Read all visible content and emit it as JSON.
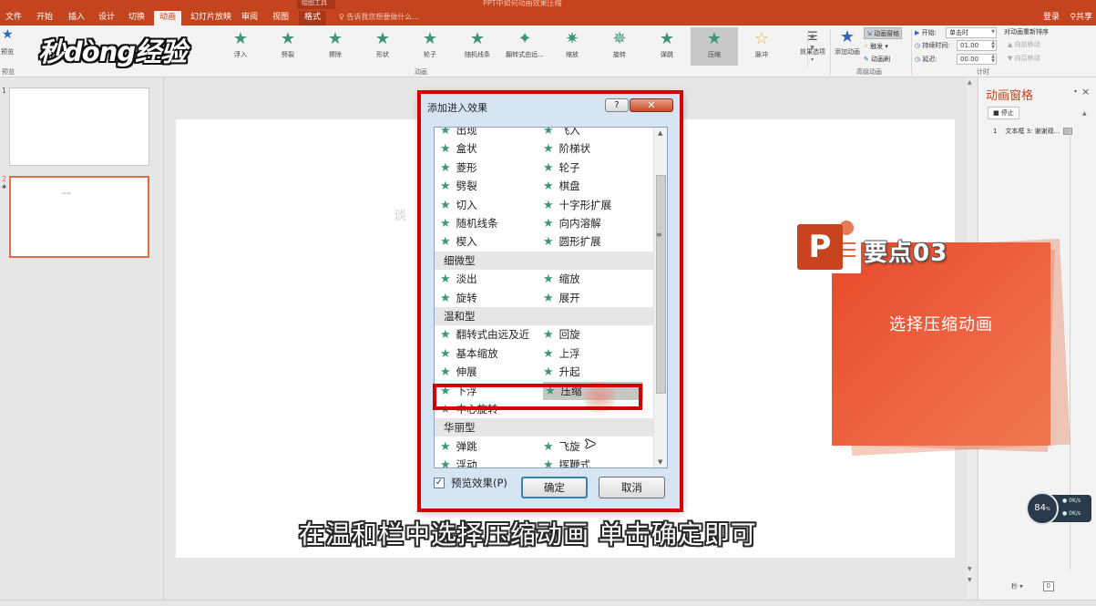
{
  "app": {
    "window_title": "PPT中如何动画效果压缩",
    "context_tab": "绘图工具"
  },
  "tabs": [
    {
      "label": "文件"
    },
    {
      "label": "开始"
    },
    {
      "label": "插入"
    },
    {
      "label": "设计"
    },
    {
      "label": "切换"
    },
    {
      "label": "动画",
      "active": true
    },
    {
      "label": "幻灯片放映"
    },
    {
      "label": "审阅"
    },
    {
      "label": "视图"
    },
    {
      "label": "格式"
    }
  ],
  "tellme_placeholder": "告诉我您想要做什么...",
  "account": {
    "login": "登录",
    "share": "共享"
  },
  "ribbon": {
    "preview_label": "预览",
    "preview_group": "预览",
    "animation_group": "动画",
    "gallery": [
      {
        "label": "浮入"
      },
      {
        "label": "劈裂"
      },
      {
        "label": "擦除"
      },
      {
        "label": "形状"
      },
      {
        "label": "轮子"
      },
      {
        "label": "随机线条"
      },
      {
        "label": "翻转式由远..."
      },
      {
        "label": "缩放"
      },
      {
        "label": "旋转"
      },
      {
        "label": "弹跳"
      },
      {
        "label": "压缩",
        "selected": true
      },
      {
        "label": "脉冲"
      }
    ],
    "effect_options": "效果选项",
    "add_animation": "添加动画",
    "advanced_group": "高级动画",
    "animation_pane_btn": "动画窗格",
    "trigger": "触发",
    "anim_painter": "动画刷",
    "timing_group": "计时",
    "start_label": "开始:",
    "start_value": "单击时",
    "duration_label": "持续时间:",
    "duration_value": "01.00",
    "delay_label": "延迟:",
    "delay_value": "00.00",
    "reorder_title": "对动画重新排序",
    "move_earlier": "向前移动",
    "move_later": "向后移动"
  },
  "thumbs": [
    {
      "num": "1",
      "text": ""
    },
    {
      "num": "2",
      "text": "****"
    }
  ],
  "anim_pane": {
    "title": "动画窗格",
    "play_btn": "停止",
    "items": [
      {
        "num": "1",
        "label": "文本框 3: 谢谢观..."
      }
    ],
    "zoom_label": "秒",
    "zoom_value": "0"
  },
  "net_widget": {
    "percent": "84",
    "unit": "%",
    "up": "0K/s",
    "down": "0K/s"
  },
  "canvas_ghost_text": "谈",
  "dialog": {
    "title": "添加进入效果",
    "help": "?",
    "close": "✕",
    "rows": [
      {
        "type": "pair",
        "left": "出现",
        "right": "飞入"
      },
      {
        "type": "pair",
        "left": "盒状",
        "right": "阶梯状"
      },
      {
        "type": "pair",
        "left": "菱形",
        "right": "轮子"
      },
      {
        "type": "pair",
        "left": "劈裂",
        "right": "棋盘"
      },
      {
        "type": "pair",
        "left": "切入",
        "right": "十字形扩展"
      },
      {
        "type": "pair",
        "left": "随机线条",
        "right": "向内溶解"
      },
      {
        "type": "pair",
        "left": "楔入",
        "right": "圆形扩展"
      },
      {
        "type": "header",
        "label": "细微型"
      },
      {
        "type": "pair",
        "left": "淡出",
        "right": "缩放"
      },
      {
        "type": "pair",
        "left": "旋转",
        "right": "展开"
      },
      {
        "type": "header",
        "label": "温和型"
      },
      {
        "type": "pair",
        "left": "翻转式由远及近",
        "right": "回旋"
      },
      {
        "type": "pair",
        "left": "基本缩放",
        "right": "上浮"
      },
      {
        "type": "pair",
        "left": "伸展",
        "right": "升起"
      },
      {
        "type": "pair",
        "left": "下浮",
        "right": "压缩",
        "selected": "right"
      },
      {
        "type": "pair",
        "left": "中心旋转",
        "right": ""
      },
      {
        "type": "header",
        "label": "华丽型"
      },
      {
        "type": "pair",
        "left": "弹跳",
        "right": "飞旋"
      },
      {
        "type": "pair",
        "left": "浮动",
        "right": "挥鞭式"
      }
    ],
    "preview_checkbox": "预览效果(P)",
    "preview_checked": true,
    "ok": "确定",
    "cancel": "取消"
  },
  "tutorial": {
    "badge": "要点03",
    "step_text": "选择压缩动画",
    "subtitle": "在温和栏中选择压缩动画 单击确定即可",
    "logo": "秒dong经验"
  },
  "colors": {
    "accent": "#c4441e",
    "star": "#3d9774",
    "highlight_red": "#d40000",
    "card": "#e54a2a"
  }
}
